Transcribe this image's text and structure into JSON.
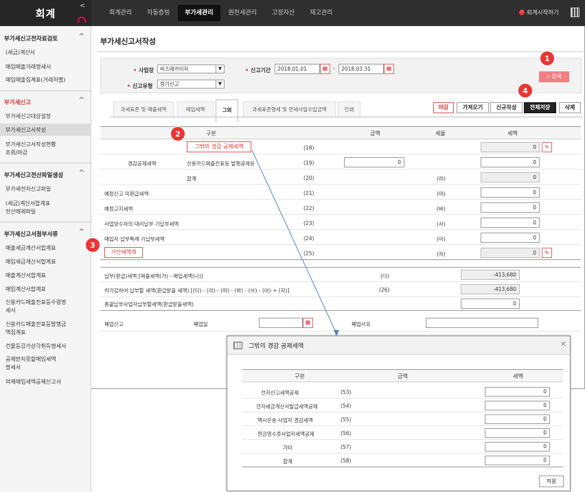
{
  "app": {
    "title": "회계",
    "start_label": "회계시작하기"
  },
  "nav": [
    "회계관리",
    "자동증빙",
    "부가세관리",
    "원천세관리",
    "고정자산",
    "재고관리"
  ],
  "sidebar": {
    "sec1": {
      "title": "부가세신고전자료검토",
      "items": [
        "(세금)계산서",
        "매입매출거래명세서",
        "매입매출집계표(거래처별)"
      ]
    },
    "sec2": {
      "title": "부가세신고",
      "items": [
        "부가세신고대상설정",
        "부가세신고서작성",
        "부가세신고서작성현황",
        "조회/마감"
      ]
    },
    "sec3": {
      "title": "부가세신고전산파일생성",
      "items": [
        "부가세전자신고파일",
        "(세금)계산서합계표",
        "전산매체파일"
      ]
    },
    "sec4": {
      "title": "부가세신고서첨부서류",
      "items": [
        "매출세금계산서합계표",
        "매입세금계산서합계표",
        "매출계산서합계표",
        "매입계산서합계표",
        "신용카드매출전표등수령명",
        "세서",
        "신용카드매출전표등발행금",
        "액집계표",
        "건물등감가상각취득명세서",
        "공제받지못할매입세액",
        "명세서",
        "의제매입세액공제신고서"
      ]
    }
  },
  "page": {
    "title": "부가세신고서작성"
  },
  "filter": {
    "biz_label": "사업장",
    "biz_value": "비즈에카이저",
    "period_label": "신고기간",
    "date_from": "2018.01.01",
    "date_to": "2018.03.31",
    "type_label": "신고유형",
    "type_value": "정기신고",
    "search": "검색"
  },
  "tabs": [
    "과세표준 및 매출세액",
    "매입세액",
    "그외",
    "과세표준명세 및 면세사업수입금액",
    "인쇄"
  ],
  "actions": {
    "close": "마감",
    "fetch": "가져오기",
    "new": "신규작성",
    "saveall": "전체저장",
    "delete": "삭제"
  },
  "table": {
    "headers": [
      "구분",
      "금액",
      "세율",
      "세액"
    ],
    "deduct_group": "경감공제세액",
    "rows": [
      {
        "label": "그밖의 경감 공제세액",
        "code": "(18)",
        "rate": "",
        "tax": "0"
      },
      {
        "label": "신용카드매출전표등 발행공제등",
        "code": "(19)",
        "rate": "",
        "amount": "0",
        "tax": "0"
      },
      {
        "label": "합계",
        "code": "(20)",
        "rate": "(라)",
        "tax": "0"
      },
      {
        "label": "예정신고 미환급세액",
        "code": "(21)",
        "rate": "(마)",
        "tax": "0"
      },
      {
        "label": "예정고지세액",
        "code": "(22)",
        "rate": "(바)",
        "tax": "0"
      },
      {
        "label": "사업양수자의 대리납부 기납부세액",
        "code": "(23)",
        "rate": "(사)",
        "tax": "0"
      },
      {
        "label": "매입자 납부특례 기납부세액",
        "code": "(24)",
        "rate": "(아)",
        "tax": "0"
      },
      {
        "label": "가산세액계",
        "code": "(25)",
        "rate": "(자)",
        "tax": "0"
      }
    ],
    "sum_rows": [
      {
        "label": "납부(환급)세액 [매출세액(가) - 매입세액(나)]",
        "code": "(다)",
        "tax": "-413,680"
      },
      {
        "label": "차가감하여 납부할 세액(환급받을 세액) [(다) - (라) - (마) - (바) - (사) - (아) + (자)]",
        "code": "(26)",
        "tax": "-413,680"
      },
      {
        "label": "총괄납부사업자납부할세액(환급받을세액)",
        "code": "",
        "tax": "0"
      }
    ],
    "closure": {
      "label": "폐업신고",
      "date_label": "폐업일",
      "reason_label": "폐업사유"
    }
  },
  "popup": {
    "title": "그밖의 경감 공제세액",
    "headers": [
      "구분",
      "금액",
      "세액"
    ],
    "rows": [
      {
        "label": "전자신고세액공제",
        "code": "(53)",
        "tax": "0"
      },
      {
        "label": "전자세금계산서발급세액공제",
        "code": "(54)",
        "tax": "0"
      },
      {
        "label": "택시운송 사업자 경감세액",
        "code": "(55)",
        "tax": "0"
      },
      {
        "label": "현금영수증사업자세액공제",
        "code": "(56)",
        "tax": "0"
      },
      {
        "label": "기타",
        "code": "(57)",
        "tax": "0"
      },
      {
        "label": "합계",
        "code": "(58)",
        "tax": "0"
      }
    ],
    "apply": "적용"
  },
  "badges": [
    "1",
    "2",
    "3",
    "4"
  ],
  "colors": {
    "accent": "#e33333",
    "topbar": "#2f2f2f",
    "search": "#f27e82"
  }
}
